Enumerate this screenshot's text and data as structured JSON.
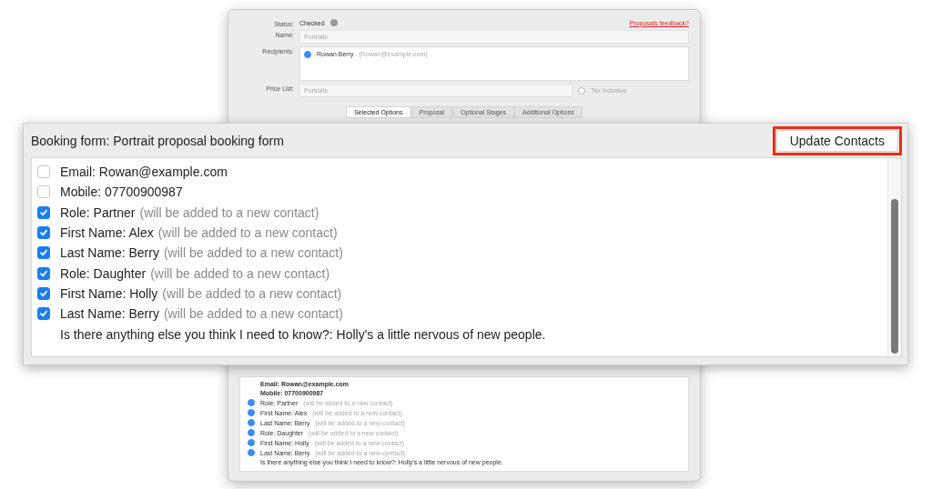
{
  "background_window": {
    "status_label": "Status:",
    "status": "Checked",
    "feedback_link": "Proposals feedback?",
    "name_label": "Name:",
    "name_value": "Portraits",
    "recipients_label": "Recipients:",
    "recipients": [
      {
        "name": "Rowan Berry",
        "email": "(Rowan@example.com)",
        "checked": true
      }
    ],
    "price_list_label": "Price List:",
    "price_list": "Portraits",
    "tax_inclusive": {
      "label": "Tax inclusive",
      "checked": false
    },
    "tabs": [
      {
        "label": "Selected Options",
        "selected": true
      },
      {
        "label": "Proposal",
        "selected": false
      },
      {
        "label": "Optional Stages",
        "selected": false
      },
      {
        "label": "Additional Options",
        "selected": false
      }
    ],
    "items": [
      {
        "label": "Email: Rowan@example.com",
        "checked": false
      },
      {
        "label": "Mobile: 07700900987",
        "checked": false
      },
      {
        "label": "Role: Partner",
        "note": "(will be added to a new contact)",
        "checked": true
      },
      {
        "label": "First Name: Alex",
        "note": "(will be added to a new contact)",
        "checked": true
      },
      {
        "label": "Last Name: Berry",
        "note": "(will be added to a new contact)",
        "checked": true
      },
      {
        "label": "Role: Daughter",
        "note": "(will be added to a new contact)",
        "checked": true
      },
      {
        "label": "First Name: Holly",
        "note": "(will be added to a new contact)",
        "checked": true
      },
      {
        "label": "Last Name: Berry",
        "note": "(will be added to a new contact)",
        "checked": true
      },
      {
        "label": "Is there anything else you think I need to know?: Holly's a little nervous of new people."
      }
    ]
  },
  "dialog": {
    "title": "Booking form: Portrait proposal booking form",
    "button": "Update Contacts",
    "items": [
      {
        "kind": "checkbox",
        "label": "Email: Rowan@example.com",
        "checked": false
      },
      {
        "kind": "checkbox",
        "label": "Mobile: 07700900987",
        "checked": false
      },
      {
        "kind": "checkbox",
        "label": "Role: Partner",
        "note": "(will be added to a new contact)",
        "checked": true
      },
      {
        "kind": "checkbox",
        "label": "First Name: Alex",
        "note": "(will be added to a new contact)",
        "checked": true
      },
      {
        "kind": "checkbox",
        "label": "Last Name: Berry",
        "note": "(will be added to a new contact)",
        "checked": true
      },
      {
        "kind": "checkbox",
        "label": "Role: Daughter",
        "note": "(will be added to a new contact)",
        "checked": true
      },
      {
        "kind": "checkbox",
        "label": "First Name: Holly",
        "note": "(will be added to a new contact)",
        "checked": true
      },
      {
        "kind": "checkbox",
        "label": "Last Name: Berry",
        "note": "(will be added to a new contact)",
        "checked": true
      },
      {
        "kind": "text",
        "label": "Is there anything else you think I need to know?: Holly's a little nervous of new people."
      }
    ]
  }
}
